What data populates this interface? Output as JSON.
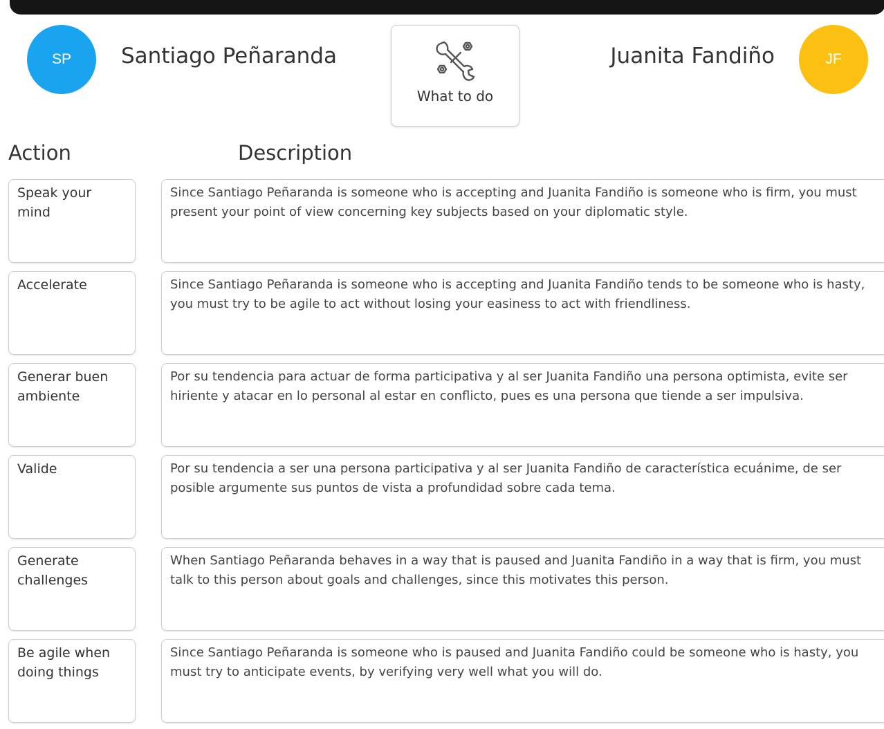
{
  "people": {
    "left": {
      "initials": "SP",
      "name": "Santiago Peñaranda",
      "avatar_color": "#1aa3ee"
    },
    "right": {
      "initials": "JF",
      "name": "Juanita Fandiño",
      "avatar_color": "#fcc012"
    }
  },
  "center_card": {
    "label": "What to do",
    "icon": "tools-icon"
  },
  "headers": {
    "action": "Action",
    "description": "Description"
  },
  "rows": [
    {
      "action": "Speak your mind",
      "description": "Since Santiago Peñaranda is someone who is accepting and Juanita Fandiño is someone who is firm, you must present your point of view concerning key subjects based on your diplomatic style."
    },
    {
      "action": "Accelerate",
      "description": "Since Santiago Peñaranda is someone who is accepting and Juanita Fandiño tends to be someone who is hasty, you must try to be agile to act without losing your easiness to act with friendliness."
    },
    {
      "action": "Generar buen ambiente",
      "description": "Por su tendencia para actuar de forma participativa y al ser Juanita Fandiño una persona optimista, evite ser hiriente y atacar en lo personal al estar en conflicto, pues es una persona que tiende a ser impulsiva."
    },
    {
      "action": "Valide",
      "description": "Por su tendencia a ser una persona participativa y al ser Juanita Fandiño de característica ecuánime, de ser posible argumente sus puntos de vista a profundidad sobre cada tema."
    },
    {
      "action": "Generate challenges",
      "description": "When Santiago Peñaranda behaves in a way that is paused and Juanita Fandiño in a way that is firm, you must talk to this person about goals and challenges, since this motivates this person."
    },
    {
      "action": "Be agile when doing things",
      "description": "Since Santiago Peñaranda is someone who is paused and Juanita Fandiño could be someone who is hasty, you must try to anticipate events, by verifying very well what you will do."
    }
  ]
}
